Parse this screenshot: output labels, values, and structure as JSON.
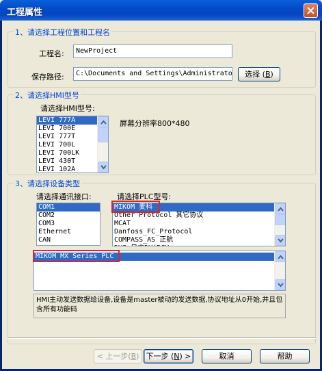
{
  "window": {
    "title": "工程属性",
    "accent": "#0349c7"
  },
  "section1": {
    "legend": "1、请选择工程位置和工程名",
    "name_label": "工程名:",
    "name_value": "NewProject",
    "path_label": "保存路径:",
    "path_value": "C:\\Documents and Settings\\Administrato",
    "browse_label": "选择",
    "browse_key": "B"
  },
  "section2": {
    "legend": "2、请选择HMI型号",
    "model_label": "请选择HMI型号:",
    "models": [
      "LEVI 777A",
      "LEVI 700E",
      "LEVI 777T",
      "LEVI 700L",
      "LEVI 700LK",
      "LEVI 430T",
      "LEVI 102A"
    ],
    "selected_model": "LEVI 777A",
    "resolution": "屏幕分辨率800*480"
  },
  "section3": {
    "legend": "3、请选择设备类型",
    "port_label": "请选择通讯接口:",
    "ports": [
      "COM1",
      "COM2",
      "COM3",
      "Ethernet",
      "CAN"
    ],
    "selected_port": "COM1",
    "plc_label": "请选择PLC型号:",
    "plc_types": [
      "MIKOM 麦科",
      "Other Protocol 其它协议",
      "MCAT",
      "Danfoss_FC_Protocol",
      "COMPASS_AS 正航",
      "DVS 日本DV(RCV"
    ],
    "selected_plc": "MIKOM 麦科",
    "plc_series": [
      "MIKOM MX Series PLC"
    ],
    "selected_series": "MIKOM MX Series PLC",
    "description": "HMI主动发送数据给设备,设备是master被动的发送数据,协议地址从0开始,并且包含所有功能码"
  },
  "buttons": {
    "back_label": "< 上一步",
    "back_key": "B",
    "next_label": "下一步",
    "next_key": "N",
    "next_suffix": ">",
    "cancel_label": "取消",
    "help_label": "帮助"
  },
  "colors": {
    "selection": "#316ac5",
    "highlight_box": "#e3212b",
    "legend_text": "#0046d5"
  }
}
